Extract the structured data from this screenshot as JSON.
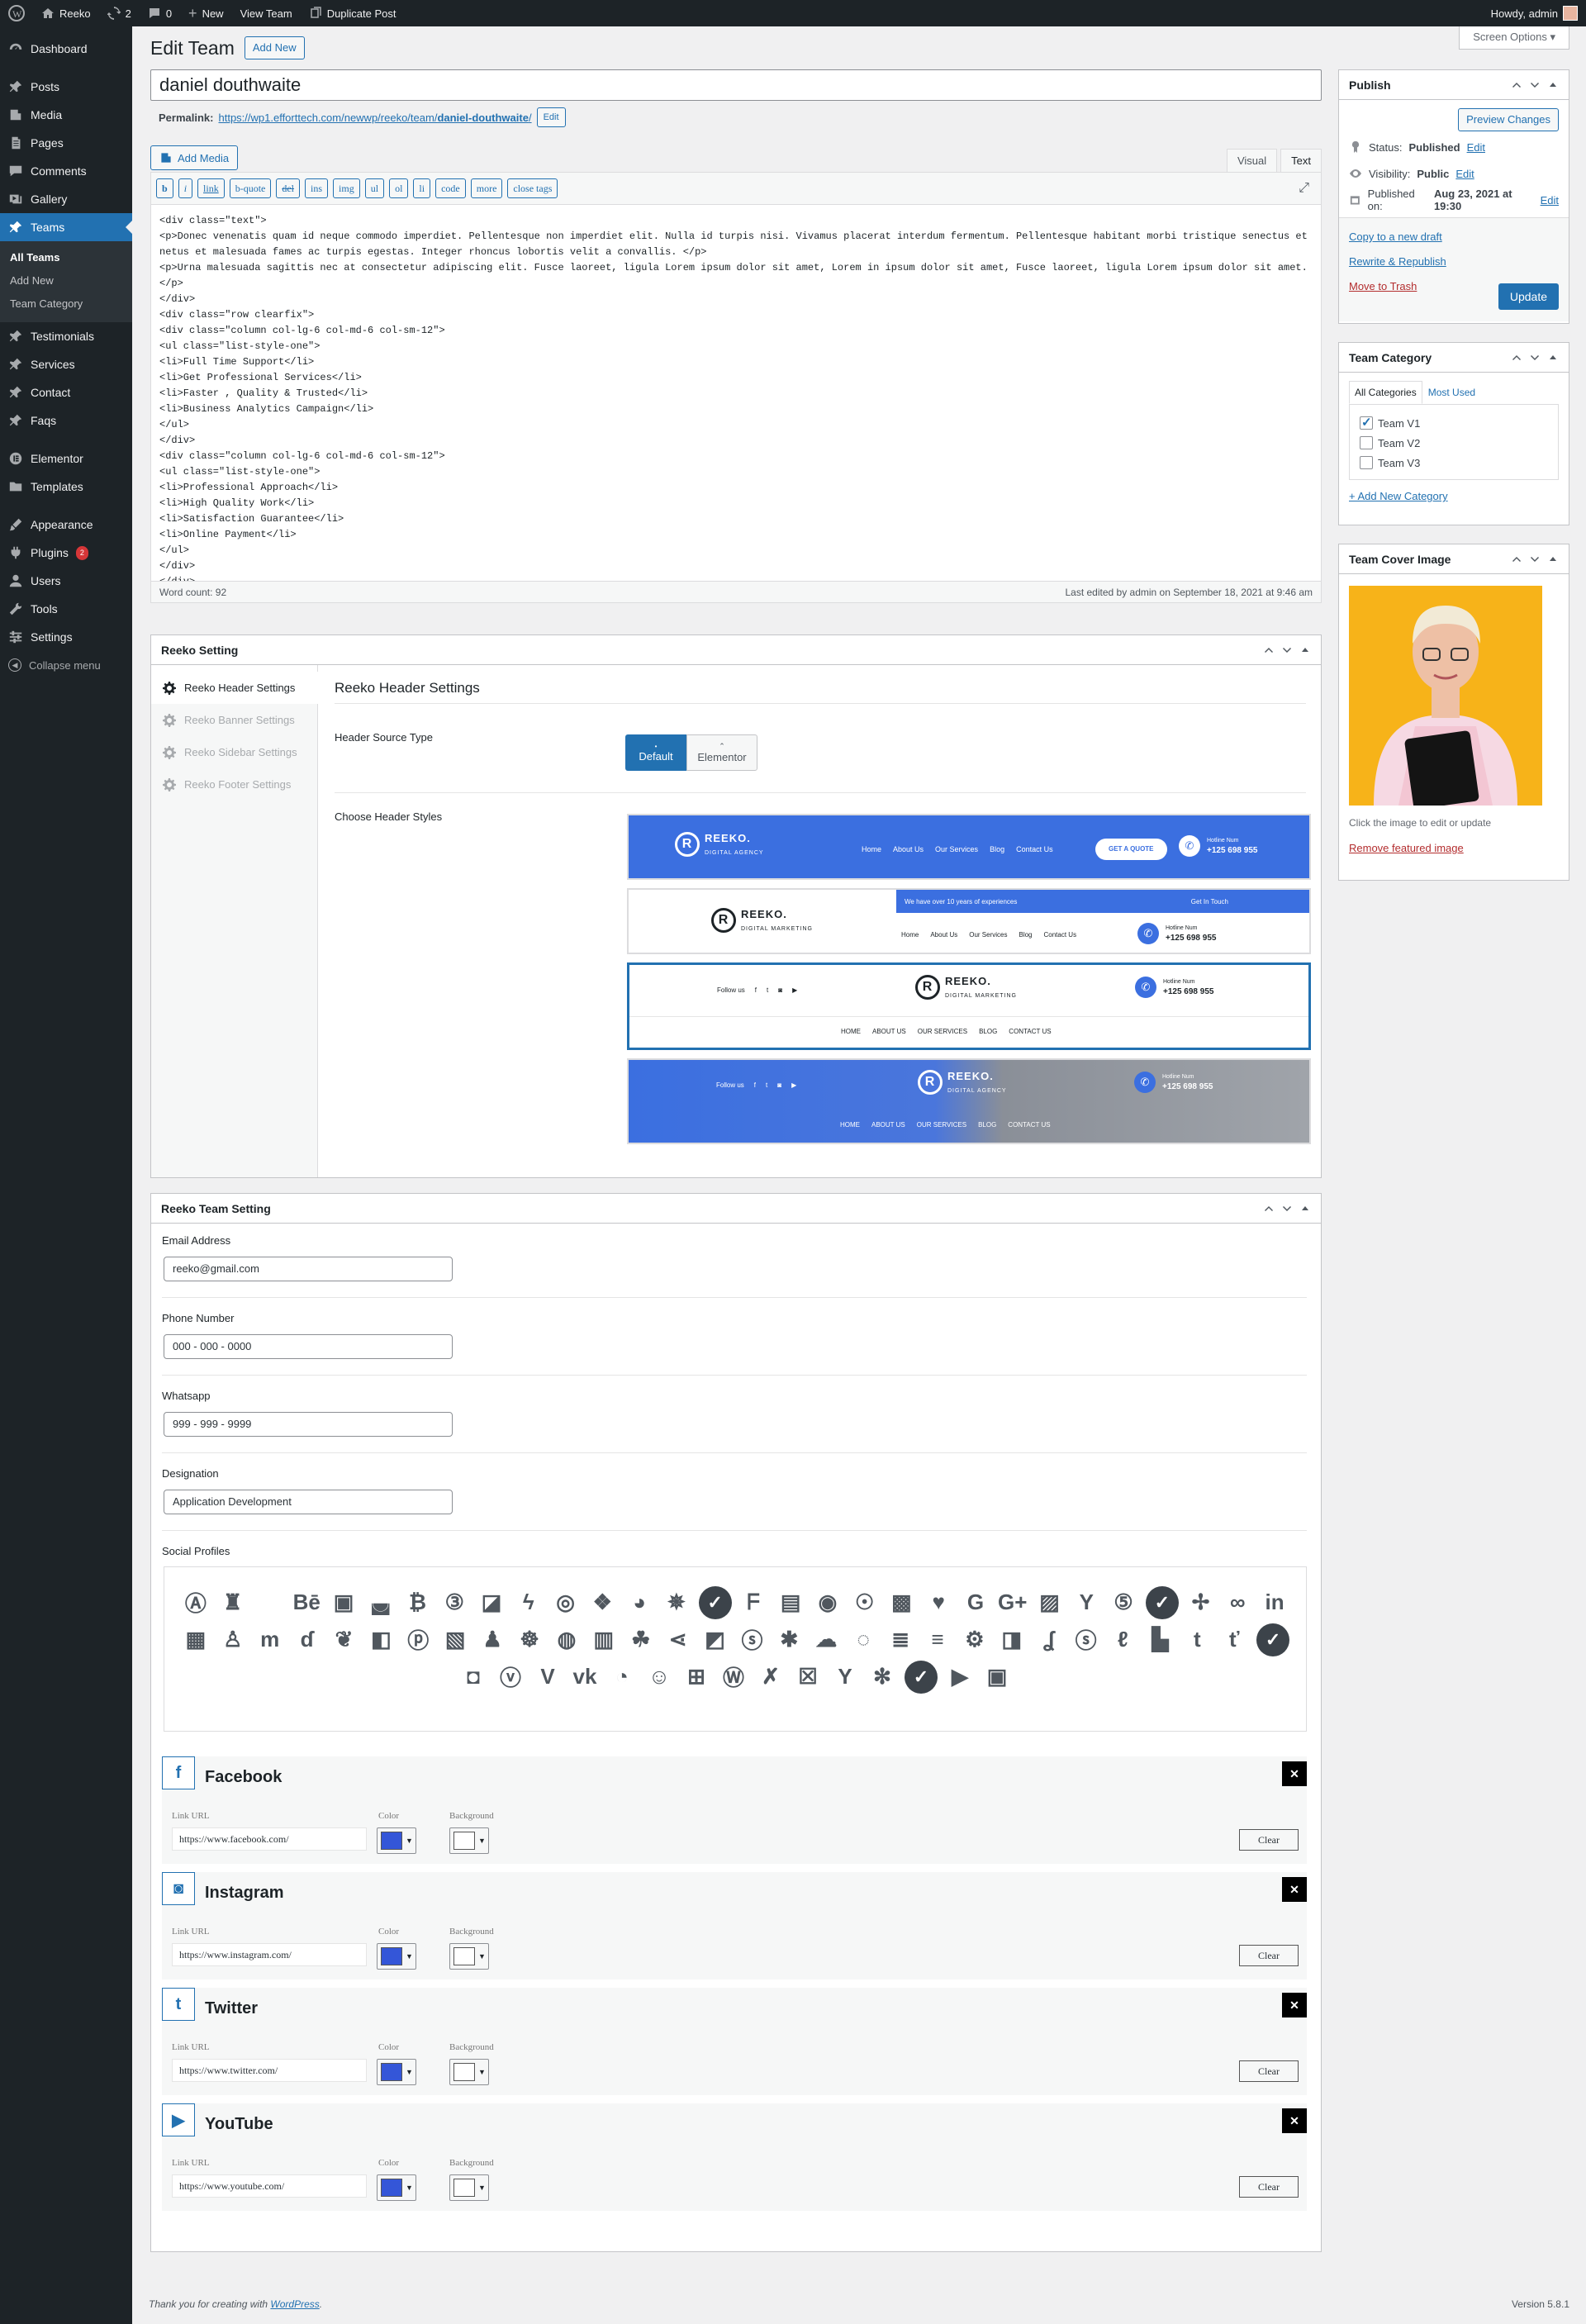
{
  "adminbar": {
    "site": "Reeko",
    "updates": "2",
    "comments": "0",
    "new": "New",
    "view": "View Team",
    "duplicate": "Duplicate Post",
    "howdy": "Howdy, admin"
  },
  "menu": {
    "dashboard": "Dashboard",
    "posts": "Posts",
    "media": "Media",
    "pages": "Pages",
    "comments": "Comments",
    "gallery": "Gallery",
    "teams": "Teams",
    "all_teams": "All Teams",
    "add_new": "Add New",
    "team_category": "Team Category",
    "testimonials": "Testimonials",
    "services": "Services",
    "contact": "Contact",
    "faqs": "Faqs",
    "elementor": "Elementor",
    "templates": "Templates",
    "appearance": "Appearance",
    "plugins": "Plugins",
    "plugins_badge": "2",
    "users": "Users",
    "tools": "Tools",
    "settings": "Settings",
    "collapse": "Collapse menu"
  },
  "screen_options": "Screen Options",
  "page": {
    "title": "Edit Team",
    "add_new": "Add New",
    "post_title": "daniel douthwaite",
    "permalink_label": "Permalink:",
    "permalink_base": "https://wp1.efforttech.com/newwp/reeko/team/",
    "permalink_slug": "daniel-douthwaite",
    "permalink_end": "/",
    "edit": "Edit"
  },
  "editor": {
    "add_media": "Add Media",
    "tab_visual": "Visual",
    "tab_text": "Text",
    "quicktags": [
      "b",
      "i",
      "link",
      "b-quote",
      "del",
      "ins",
      "img",
      "ul",
      "ol",
      "li",
      "code",
      "more",
      "close tags"
    ],
    "content": "<div class=\"text\">\n<p>Donec venenatis quam id neque commodo imperdiet. Pellentesque non imperdiet elit. Nulla id turpis nisi. Vivamus placerat interdum fermentum. Pellentesque habitant morbi tristique senectus et netus et malesuada fames ac turpis egestas. Integer rhoncus lobortis velit a convallis. </p>\n<p>Urna malesuada sagittis nec at consectetur adipiscing elit. Fusce laoreet, ligula Lorem ipsum dolor sit amet, Lorem in ipsum dolor sit amet, Fusce laoreet, ligula Lorem ipsum dolor sit amet.</p>\n</div>\n<div class=\"row clearfix\">\n<div class=\"column col-lg-6 col-md-6 col-sm-12\">\n<ul class=\"list-style-one\">\n<li>Full Time Support</li>\n<li>Get Professional Services</li>\n<li>Faster , Quality & Trusted</li>\n<li>Business Analytics Campaign</li>\n</ul>\n</div>\n<div class=\"column col-lg-6 col-md-6 col-sm-12\">\n<ul class=\"list-style-one\">\n<li>Professional Approach</li>\n<li>High Quality Work</li>\n<li>Satisfaction Guarantee</li>\n<li>Online Payment</li>\n</ul>\n</div>\n</div>",
    "word_count": "Word count: 92",
    "last_edited": "Last edited by admin on September 18, 2021 at 9:46 am"
  },
  "publish": {
    "title": "Publish",
    "preview": "Preview Changes",
    "status_label": "Status:",
    "status": "Published",
    "visibility_label": "Visibility:",
    "visibility": "Public",
    "published_label": "Published on:",
    "published": "Aug 23, 2021 at 19:30",
    "edit": "Edit",
    "copy_draft": "Copy to a new draft",
    "rewrite": "Rewrite & Republish",
    "trash": "Move to Trash",
    "update": "Update"
  },
  "category": {
    "title": "Team Category",
    "tab_all": "All Categories",
    "tab_used": "Most Used",
    "items": [
      "Team V1",
      "Team V2",
      "Team V3"
    ],
    "add_new": "+ Add New Category"
  },
  "cover": {
    "title": "Team Cover Image",
    "hint": "Click the image to edit or update",
    "remove": "Remove featured image"
  },
  "reeko_setting": {
    "title": "Reeko Setting",
    "menu": [
      "Reeko Header Settings",
      "Reeko Banner Settings",
      "Reeko Sidebar Settings",
      "Reeko Footer Settings"
    ],
    "heading": "Reeko Header Settings",
    "source_label": "Header Source Type",
    "opt_default": "Default",
    "opt_elementor": "Elementor",
    "styles_label": "Choose Header Styles",
    "hdr": {
      "logo": "REEKO.",
      "tag1": "DIGITAL AGENCY",
      "tag2": "DIGITAL MARKETING",
      "nav1": [
        "Home",
        "About Us",
        "Our Services",
        "Blog",
        "Contact Us"
      ],
      "nav2": [
        "HOME",
        "ABOUT US",
        "OUR SERVICES",
        "BLOG",
        "CONTACT US"
      ],
      "quote": "GET A QUOTE",
      "hotline": "Hotline Num",
      "phone": "+125 698 955",
      "exp": "We have over 10 years of experiences",
      "touch": "Get In Touch",
      "follow": "Follow us"
    }
  },
  "team_setting": {
    "title": "Reeko Team Setting",
    "email_label": "Email Address",
    "email": "reeko@gmail.com",
    "phone_label": "Phone Number",
    "phone": "000 - 000 - 0000",
    "whatsapp_label": "Whatsapp",
    "whatsapp": "999 - 999 - 9999",
    "designation_label": "Designation",
    "designation": "Application Development",
    "social_label": "Social Profiles",
    "link_label": "Link URL",
    "color_label": "Color",
    "bg_label": "Background",
    "clear": "Clear",
    "profiles": [
      {
        "name": "Facebook",
        "url": "https://www.facebook.com/"
      },
      {
        "name": "Instagram",
        "url": "https://www.instagram.com/"
      },
      {
        "name": "Twitter",
        "url": "https://www.twitter.com/"
      },
      {
        "name": "YouTube",
        "url": "https://www.youtube.com/"
      }
    ]
  },
  "footer": {
    "thanks": "Thank you for creating with ",
    "wp": "WordPress",
    "dot": ".",
    "version": "Version 5.8.1"
  },
  "colors": {
    "accent": "#2271b1",
    "swatch": "#3456d8",
    "header_blue": "#3b6fe0"
  }
}
